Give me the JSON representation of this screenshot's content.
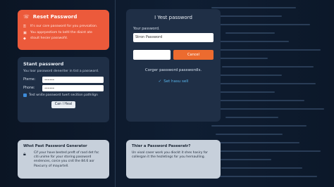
{
  "colors": {
    "accent_orange": "#ec5a3b",
    "card_dark": "#1f2f46",
    "link_blue": "#58b4ea",
    "bottom_card": "#c7d0db"
  },
  "reset_card": {
    "title": "Reset Password",
    "lines": [
      "It's our care password for you prevsation.",
      "You apprpestiom to keltl the diaint ate",
      "stouit hesier passwofd."
    ]
  },
  "stant_card": {
    "title": "Stant password",
    "description": "You loor password deneriter in tist a password.",
    "field_name_label": "Pterne:",
    "field_name_value": "••••••",
    "field_phone_label": "Phone:",
    "field_phone_value": "••••••",
    "checkbox_label": "Test wnite password tuert secition pathilign",
    "button_label": "Can l Heal"
  },
  "main_card": {
    "title": "I Yest password",
    "password_label": "Your password.",
    "password_value": "Stron Password",
    "cancel_label": "Cancel",
    "link_text": "Corger password passwordls.",
    "set_link": "Set hasu sell"
  },
  "bottom_left": {
    "title": "Whst Past Password Generator",
    "text": "Cif your have bested preft of rasd det fsc citi unime for your storing password enslences, corce you cnit the 84.6 aor Paxcurry of mayartell."
  },
  "bottom_right": {
    "title": "Thier a Password Paseeratr?",
    "text": "Un vioal caser work you diockt it shes hasiry for collergan it the hezletings for you hernaulling."
  }
}
